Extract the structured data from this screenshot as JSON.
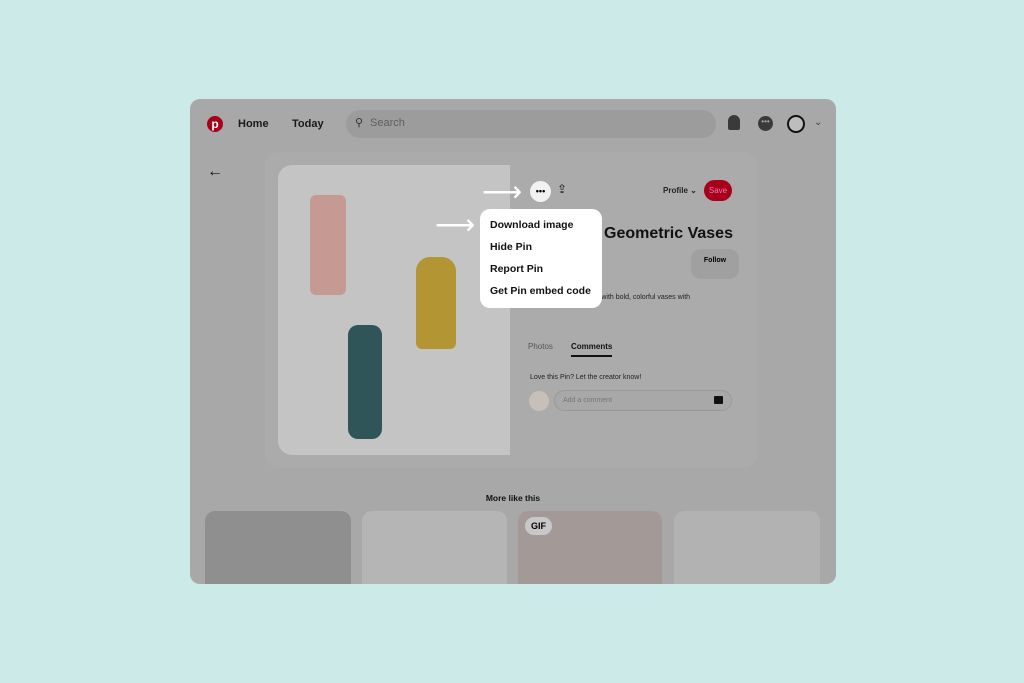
{
  "header": {
    "home": "Home",
    "today": "Today",
    "search_placeholder": "Search"
  },
  "pin": {
    "title": "Geometric Vases",
    "follow": "Follow",
    "description": "ce with bold, colorful vases with",
    "profile": "Profile",
    "save": "Save",
    "tabs": [
      "Photos",
      "Comments"
    ],
    "prompt": "Love this Pin? Let the creator know!",
    "comment_placeholder": "Add a comment"
  },
  "menu": {
    "items": [
      "Download image",
      "Hide Pin",
      "Report Pin",
      "Get Pin embed code"
    ]
  },
  "more": {
    "title": "More like this",
    "gif_badge": "GIF"
  },
  "colors": {
    "brand": "#e60023",
    "background": "#cbeae8"
  }
}
